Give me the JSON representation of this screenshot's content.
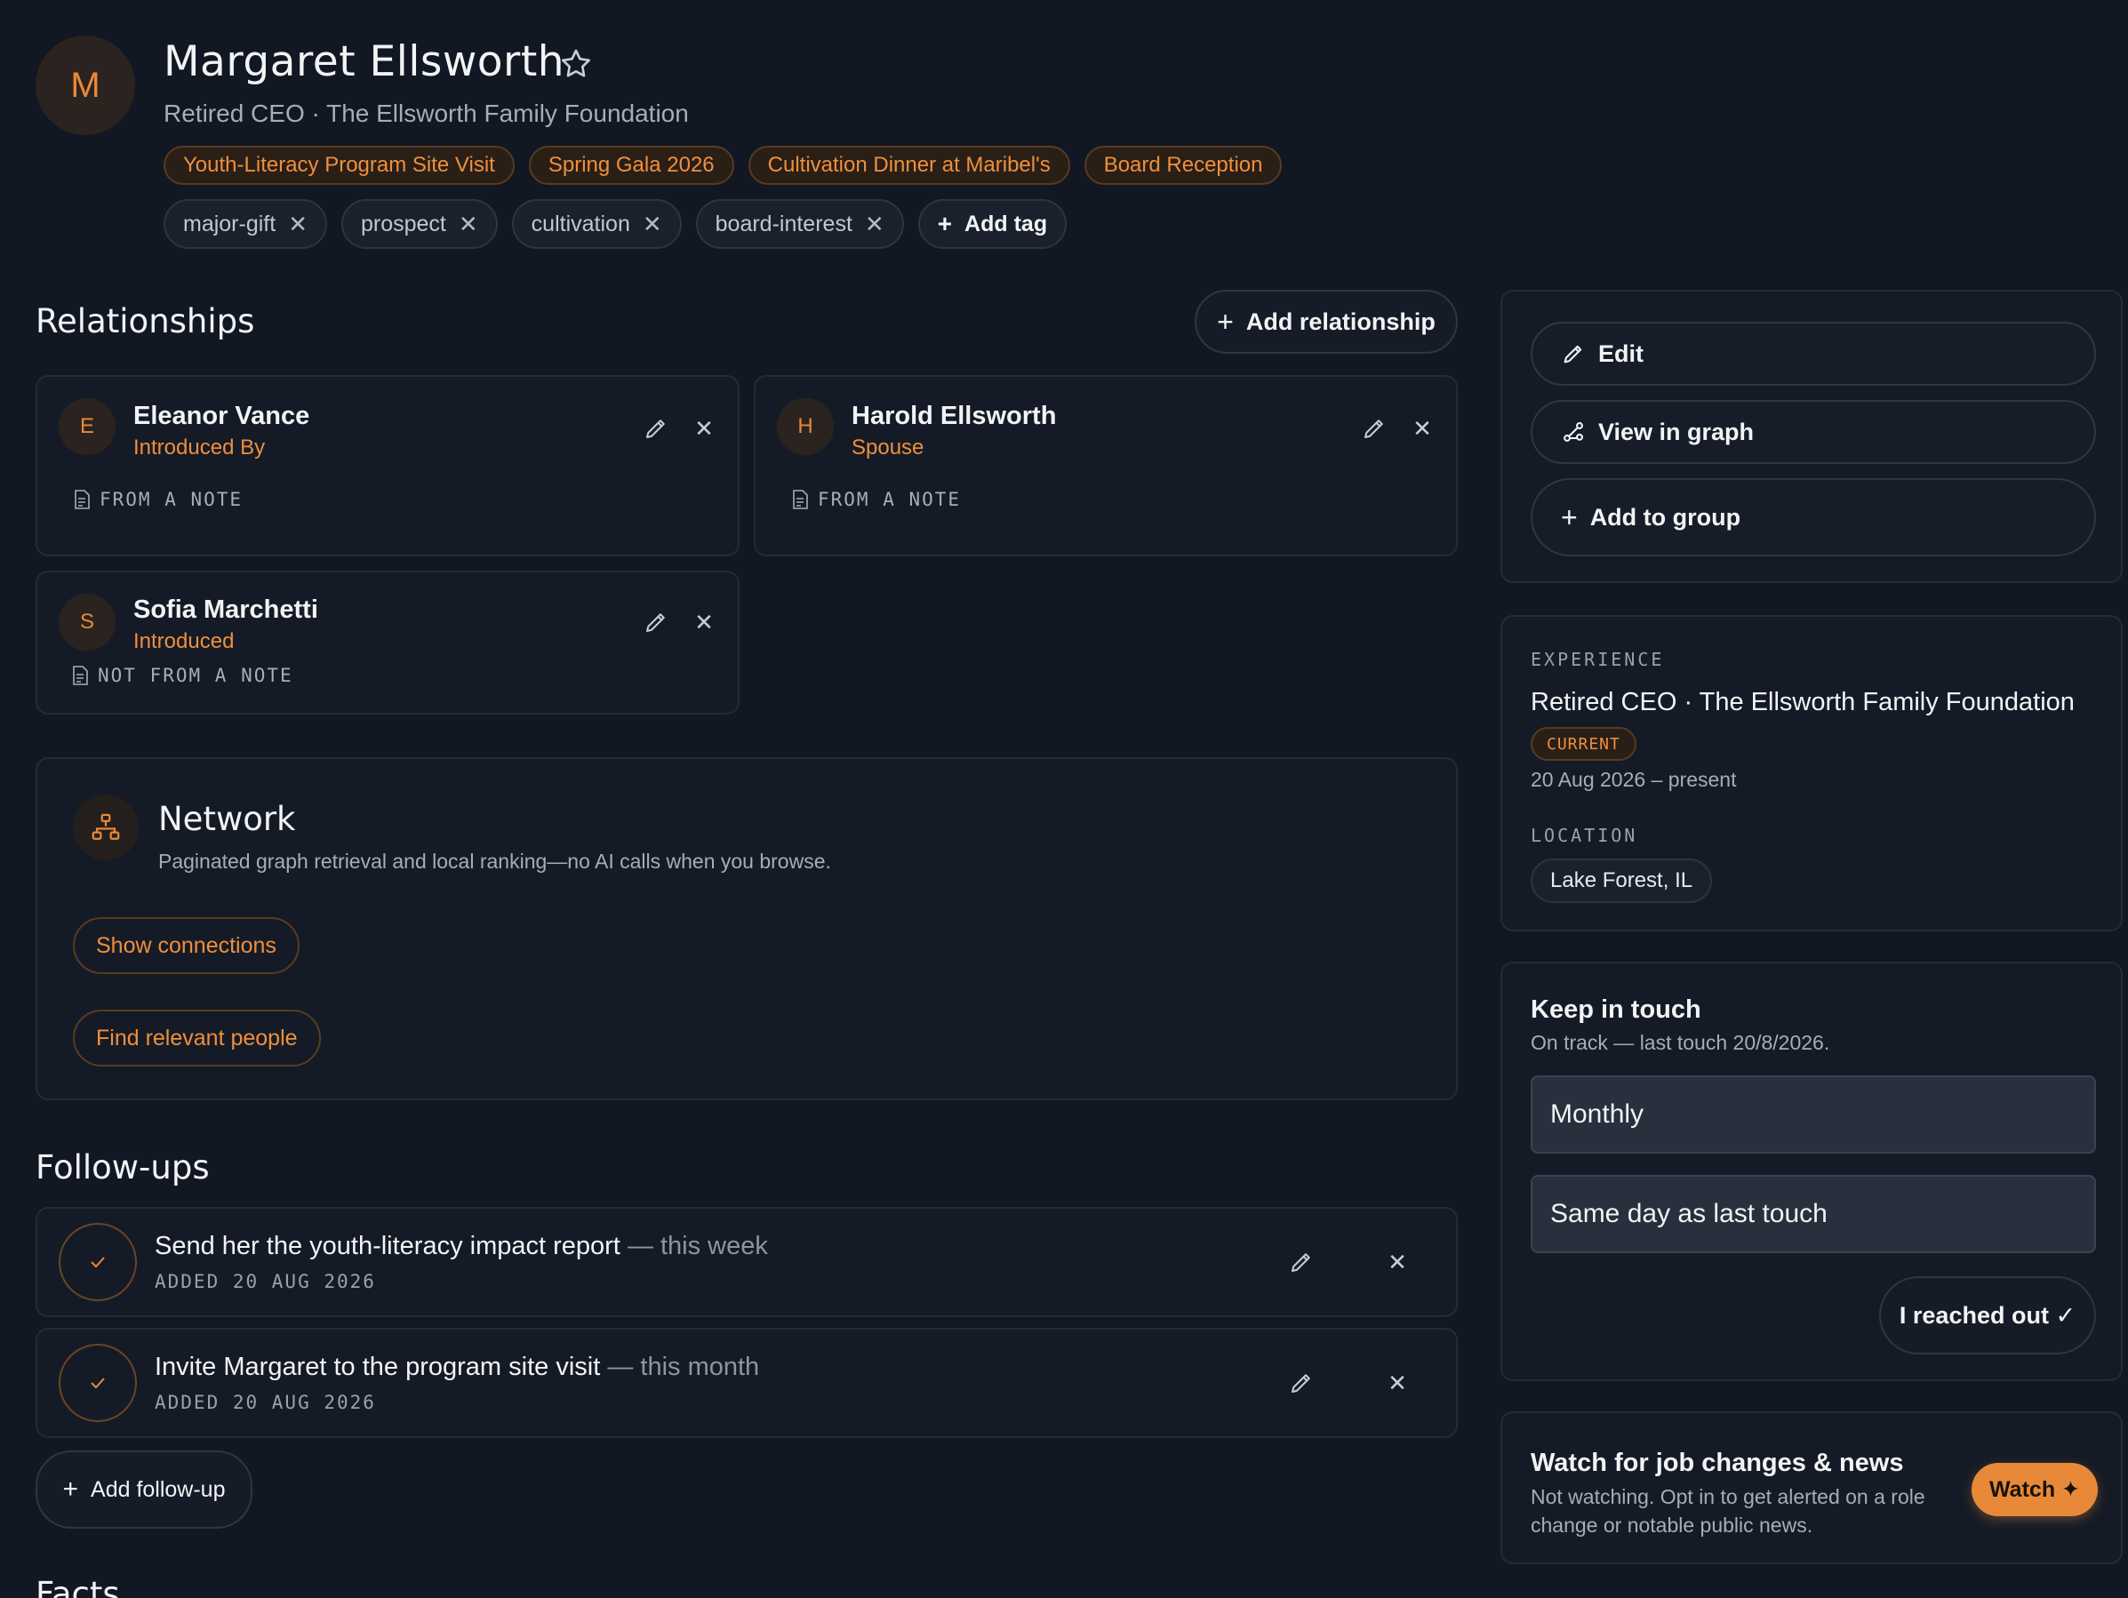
{
  "profile": {
    "avatar_initial": "M",
    "name": "Margaret Ellsworth",
    "subtitle": "Retired CEO · The Ellsworth Family Foundation",
    "events": [
      "Youth-Literacy Program Site Visit",
      "Spring Gala 2026",
      "Cultivation Dinner at Maribel's",
      "Board Reception"
    ],
    "tags": [
      "major-gift",
      "prospect",
      "cultivation",
      "board-interest"
    ],
    "add_tag_label": "Add tag"
  },
  "relationships": {
    "title": "Relationships",
    "add_label": "Add relationship",
    "items": [
      {
        "initial": "E",
        "name": "Eleanor Vance",
        "role": "Introduced By",
        "note": "FROM A NOTE"
      },
      {
        "initial": "H",
        "name": "Harold Ellsworth",
        "role": "Spouse",
        "note": "FROM A NOTE"
      },
      {
        "initial": "S",
        "name": "Sofia Marchetti",
        "role": "Introduced",
        "note": "NOT FROM A NOTE"
      }
    ]
  },
  "network": {
    "title": "Network",
    "description": "Paginated graph retrieval and local ranking—no AI calls when you browse.",
    "show_connections_label": "Show connections",
    "find_people_label": "Find relevant people"
  },
  "followups": {
    "title": "Follow-ups",
    "items": [
      {
        "text": "Send her the youth-literacy impact report",
        "when": "— this week",
        "added": "ADDED 20 AUG 2026"
      },
      {
        "text": "Invite Margaret to the program site visit",
        "when": "— this month",
        "added": "ADDED 20 AUG 2026"
      }
    ],
    "add_label": "Add follow-up"
  },
  "facts": {
    "title": "Facts"
  },
  "actions": {
    "edit_label": "Edit",
    "graph_label": "View in graph",
    "group_label": "Add to group"
  },
  "experience": {
    "label": "EXPERIENCE",
    "role": "Retired CEO · The Ellsworth Family Foundation",
    "badge": "CURRENT",
    "dates": "20 Aug 2026 – present",
    "location_label": "LOCATION",
    "location": "Lake Forest, IL"
  },
  "keep_in_touch": {
    "title": "Keep in touch",
    "status": "On track — last touch 20/8/2026.",
    "frequency": "Monthly",
    "anchor": "Same day as last touch",
    "reached_label": "I reached out ✓"
  },
  "watch": {
    "title": "Watch for job changes & news",
    "description": "Not watching. Opt in to get alerted on a role change or notable public news.",
    "button_label": "Watch ✦"
  },
  "colors": {
    "accent": "#e8893a",
    "background": "#111723",
    "card": "#151b26"
  }
}
